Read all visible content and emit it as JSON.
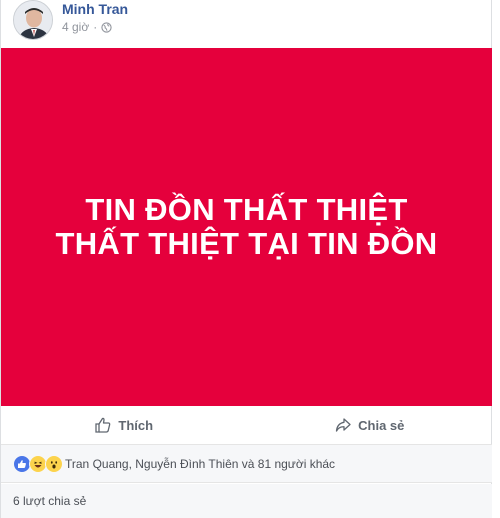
{
  "post": {
    "author": "Minh Tran",
    "time": "4 giờ",
    "separator": "·",
    "privacy_icon": "globe-icon"
  },
  "banner": {
    "line1": "TIN ĐỒN THẤT THIỆT",
    "line2": "THẤT THIỆT TẠI TIN ĐỒN",
    "background": "#e5003c"
  },
  "actions": {
    "like_label": "Thích",
    "share_label": "Chia sẻ"
  },
  "reactions": {
    "icons": [
      "like-icon",
      "haha-icon",
      "wow-icon"
    ],
    "text": "Tran Quang, Nguyễn Đình Thiên và 81 người khác"
  },
  "shares": {
    "text": "6 lượt chia sẻ"
  },
  "colors": {
    "link": "#365899",
    "muted": "#90949c",
    "like_blue": "#4a76e8"
  }
}
